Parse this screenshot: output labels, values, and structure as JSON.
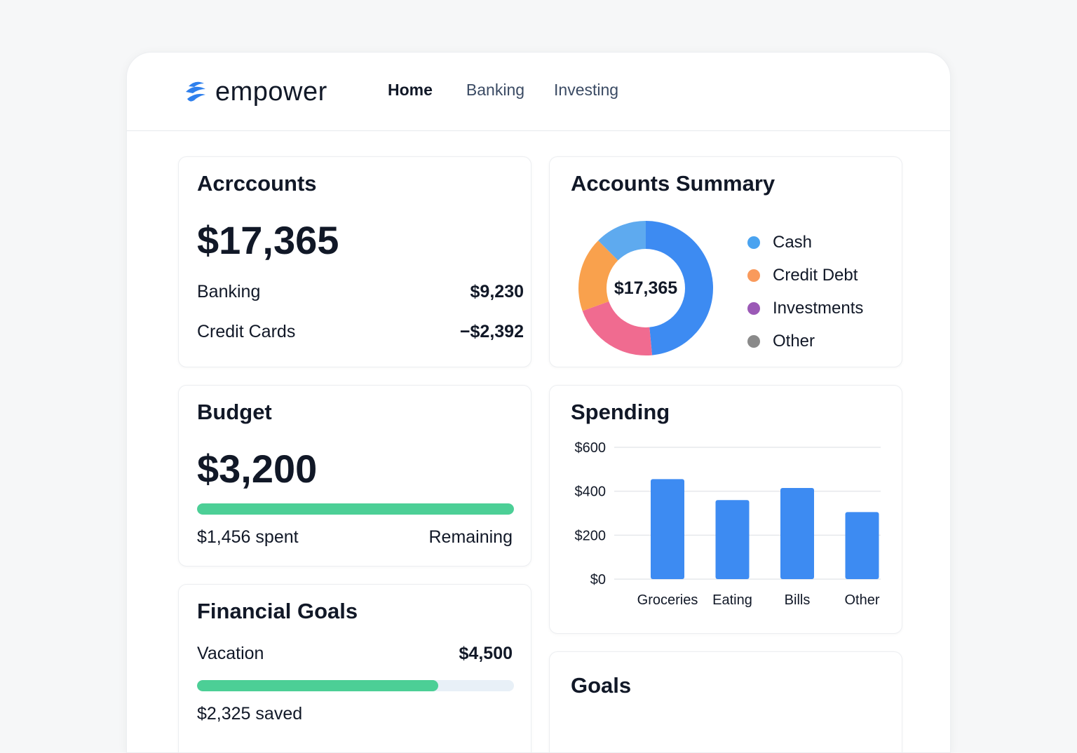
{
  "app": {
    "brand": "empower"
  },
  "nav": [
    {
      "label": "Home",
      "active": true
    },
    {
      "label": "Banking",
      "active": false
    },
    {
      "label": "Investing",
      "active": false
    }
  ],
  "accounts": {
    "title": "Acrccounts",
    "total": "$17,365",
    "rows": [
      {
        "label": "Banking",
        "value": "$9,230"
      },
      {
        "label": "Credit Cards",
        "value": "−$2,392"
      }
    ]
  },
  "summary": {
    "title": "Accounts Summary",
    "center_label": "$17,365",
    "legend": [
      {
        "label": "Cash",
        "color": "#4aa3f0"
      },
      {
        "label": "Credit Debt",
        "color": "#f99a5c"
      },
      {
        "label": "Investments",
        "color": "#9b59b6"
      },
      {
        "label": "Other",
        "color": "#8a8a8a"
      }
    ],
    "segments": [
      {
        "color": "#3d8bf2",
        "fraction": 0.485
      },
      {
        "color": "#f06b90",
        "fraction": 0.21
      },
      {
        "color": "#f9a14d",
        "fraction": 0.18
      },
      {
        "color": "#5eaaef",
        "fraction": 0.125
      }
    ]
  },
  "budget": {
    "title": "Budget",
    "amount": "$3,200",
    "progress": 1.0,
    "spent_label": "$1,456 spent",
    "remaining_label": "Remaining"
  },
  "spending": {
    "title": "Spending",
    "chart_data": {
      "type": "bar",
      "categories": [
        "Groceries",
        "Eating",
        "Bills",
        "Other"
      ],
      "values": [
        455,
        360,
        415,
        305
      ],
      "ylim": [
        0,
        600
      ],
      "yticks": [
        "$0",
        "$200",
        "$400",
        "$600"
      ],
      "ytick_values": [
        0,
        200,
        400,
        600
      ],
      "color": "#3d8bf2",
      "grid": true
    }
  },
  "financial_goals": {
    "title": "Financial Goals",
    "goal_label": "Vacation",
    "goal_value": "$4,500",
    "progress": 0.76,
    "saved_label": "$2,325 saved"
  },
  "goals": {
    "title": "Goals"
  }
}
